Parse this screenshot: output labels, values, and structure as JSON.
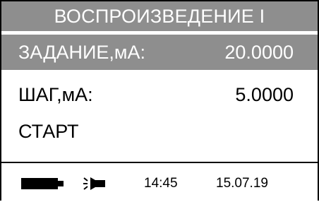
{
  "screen": {
    "title": "ВОСПРОИЗВЕДЕНИЕ I"
  },
  "menu": {
    "target": {
      "label": "ЗАДАНИЕ,мА:",
      "value": "20.0000"
    },
    "step": {
      "label": "ШАГ,мА:",
      "value": "5.0000"
    },
    "start": {
      "label": "СТАРТ"
    }
  },
  "status": {
    "battery_icon": "battery-icon",
    "light_icon": "backlight-icon",
    "time": "14:45",
    "date": "15.07.19"
  },
  "colors": {
    "highlight": "#8e8e8e",
    "foreground": "#000000",
    "background": "#ffffff"
  }
}
